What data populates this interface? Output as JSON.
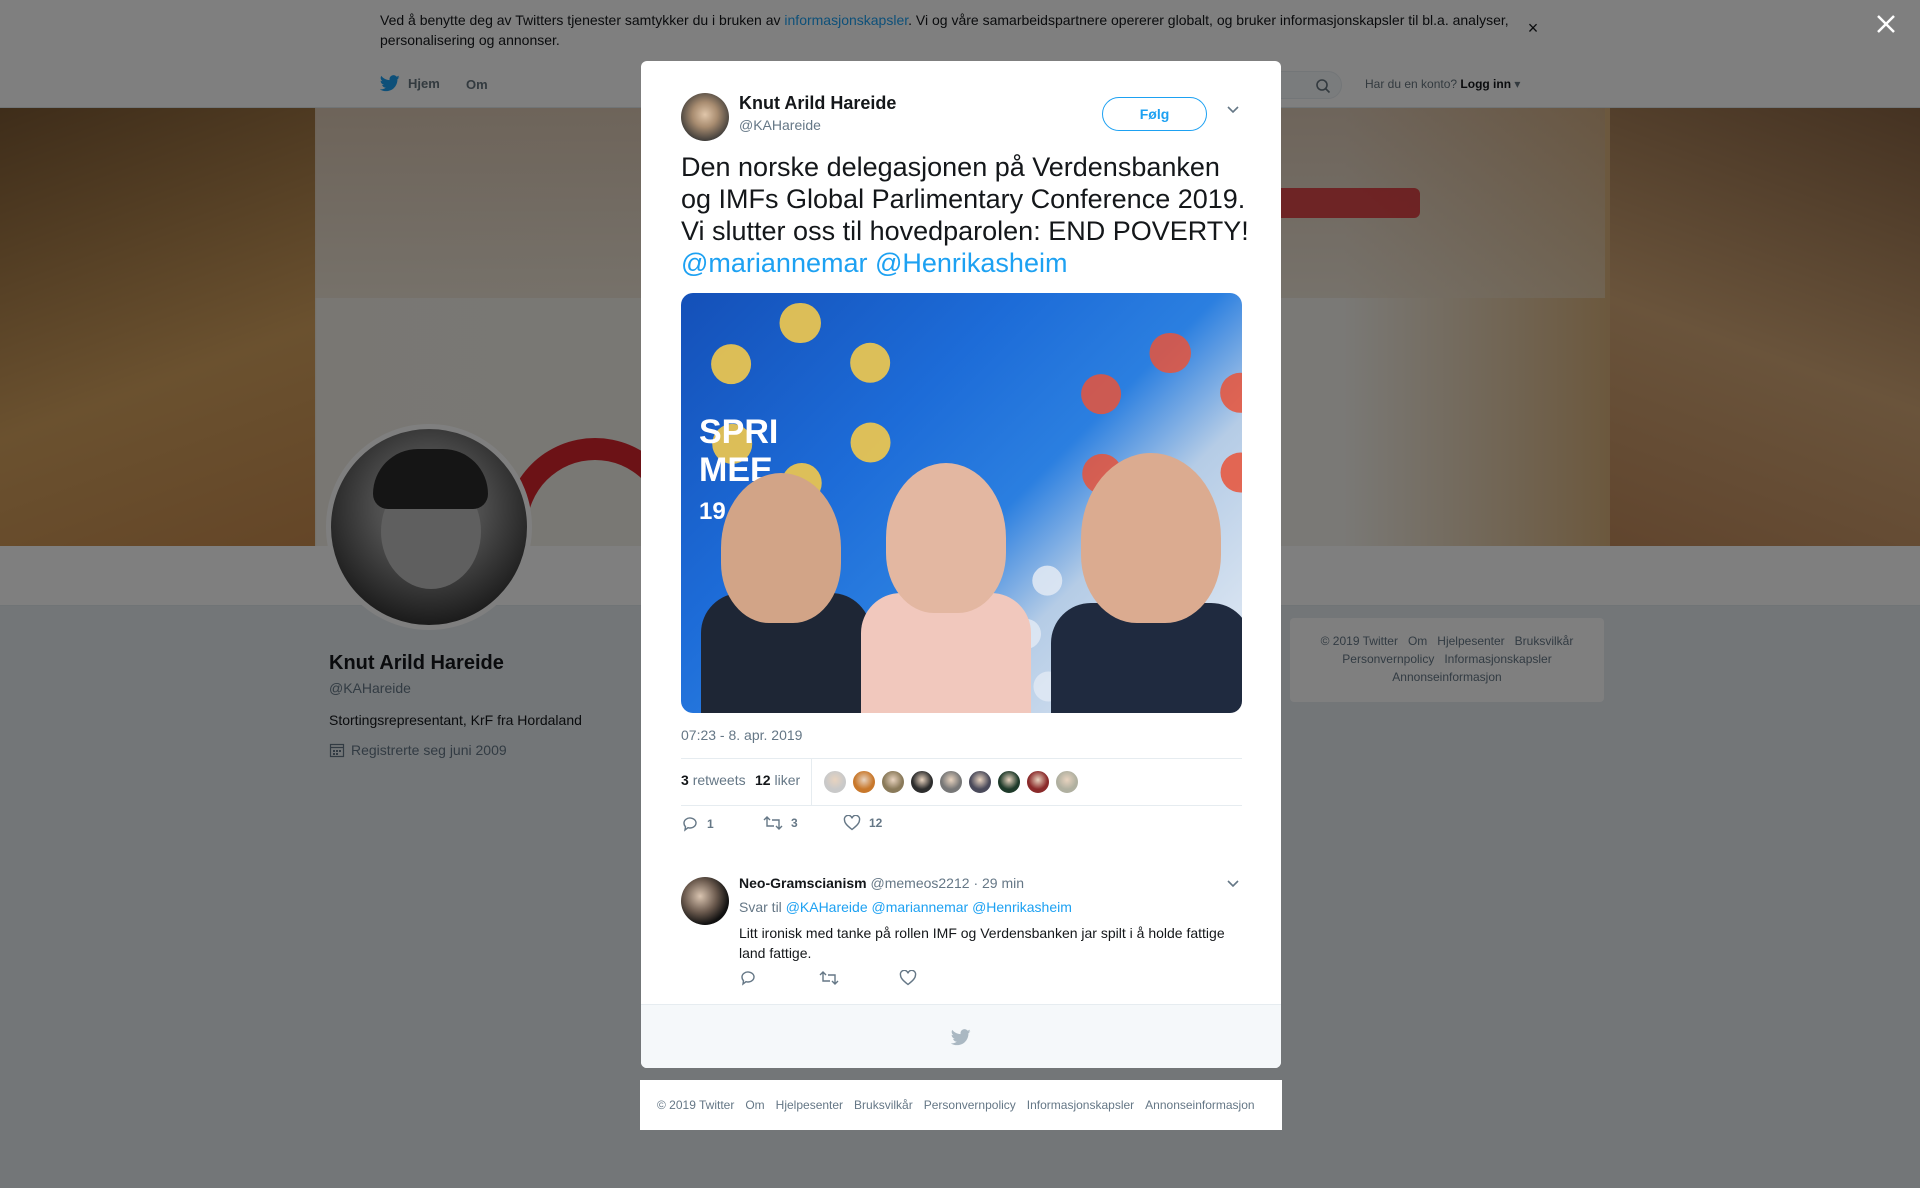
{
  "cookie": {
    "text_before": "Ved å benytte deg av Twitters tjenester samtykker du i bruken av ",
    "link": "informasjonskapsler",
    "text_after": ". Vi og våre samarbeidspartnere opererer globalt, og bruker informasjonskapsler til bl.a. analyser, personalisering og annonser.",
    "close": "×"
  },
  "nav": {
    "home": "Hjem",
    "about": "Om",
    "login_prompt": "Har du en konto?",
    "login": "Logg inn"
  },
  "profile": {
    "name": "Knut Arild Hareide",
    "handle": "@KAHareide",
    "bio": "Stortingsrepresentant, KrF fra Hordaland",
    "joined": "Registrerte seg juni 2009"
  },
  "side_footer": {
    "items": [
      "© 2019 Twitter",
      "Om",
      "Hjelpesenter",
      "Bruksvilkår",
      "Personvernpolicy",
      "Informasjonskapsler",
      "Annonseinformasjon"
    ]
  },
  "tweet": {
    "author_name": "Knut Arild Hareide",
    "author_handle": "@KAHareide",
    "follow_label": "Følg",
    "text": "Den norske delegasjonen på Verdensbanken og IMFs Global Parlimentary Conference 2019. Vi slutter oss til hovedparolen: END POVERTY!",
    "mention1": "@mariannemar",
    "mention2": "@Henrikasheim",
    "photo_text_line1": "SPRI",
    "photo_text_line2": "MEE",
    "photo_text_line3": "19 | W",
    "time": "07:23 - 8. apr. 2019",
    "retweets_count": "3",
    "retweets_label": "retweets",
    "likes_count": "12",
    "likes_label": "liker",
    "reply_count": "1",
    "retweet_action_count": "3",
    "like_action_count": "12",
    "liker_colors": [
      "#c9c9c9",
      "#c8782c",
      "#8a7a5a",
      "#2d2d2d",
      "#777777",
      "#4a4a5a",
      "#1e3a2a",
      "#8a2a2a",
      "#b0b0a0"
    ]
  },
  "reply": {
    "name": "Neo-Gramscianism",
    "handle": "@memeos2212",
    "time": "· 29 min",
    "reply_to_label": "Svar til",
    "reply_to_mentions": [
      "@KAHareide",
      "@mariannemar",
      "@Henrikasheim"
    ],
    "text": "Litt ironisk med tanke på rollen IMF og Verdensbanken jar spilt i å holde fattige land fattige."
  },
  "bottom_footer": {
    "items": [
      "© 2019 Twitter",
      "Om",
      "Hjelpesenter",
      "Bruksvilkår",
      "Personvernpolicy",
      "Informasjonskapsler",
      "Annonseinformasjon"
    ]
  },
  "colors": {
    "accent": "#1da1f2",
    "overlay": "rgba(0,0,0,0.5)"
  }
}
